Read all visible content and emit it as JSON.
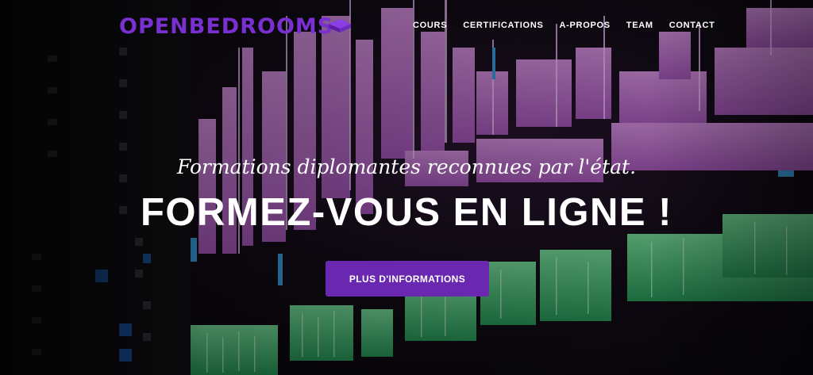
{
  "brand": {
    "logo_text": "OPENBEDROOMS"
  },
  "nav": {
    "items": [
      "COURS",
      "CERTIFICATIONS",
      "A-PROPOS",
      "TEAM",
      "CONTACT"
    ]
  },
  "hero": {
    "subtitle": "Formations diplomantes reconnues par l'état.",
    "headline": "FORMEZ-VOUS EN LIGNE !",
    "cta_label": "PLUS D'INFORMATIONS",
    "background_icon": "video-editing-timeline-photo"
  },
  "colors": {
    "accent": "#6a27b0",
    "logo": "#7a2fd1",
    "text": "#ffffff"
  }
}
